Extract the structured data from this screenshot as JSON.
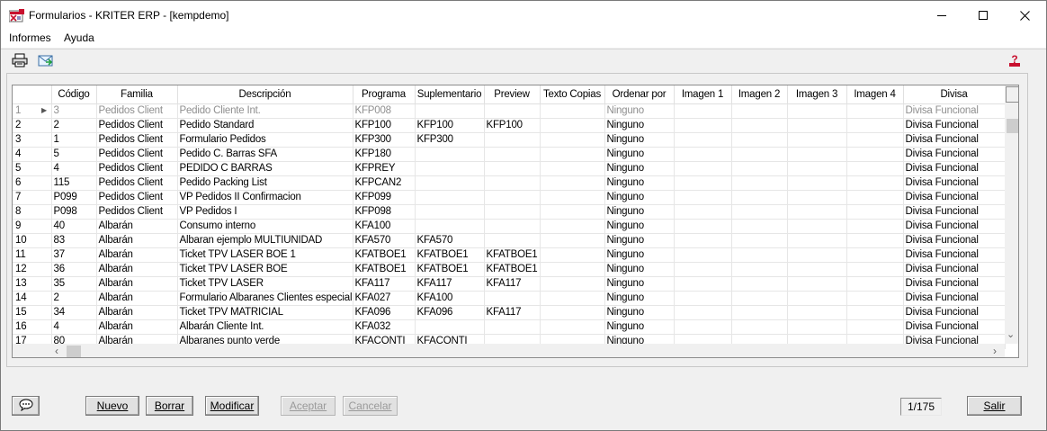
{
  "window": {
    "title": "Formularios - KRITER ERP - [kempdemo]",
    "controls": {
      "minimize": "—",
      "maximize": "☐",
      "close": "✕"
    }
  },
  "menu": {
    "informes": "Informes",
    "ayuda": "Ayuda"
  },
  "toolbar": {
    "icons": [
      "printer-icon",
      "email-export-icon",
      "help-icon"
    ]
  },
  "grid": {
    "columns": [
      "",
      "Código",
      "Familia",
      "Descripción",
      "Programa",
      "Suplementario",
      "Preview",
      "Texto Copias",
      "Ordenar por",
      "Imagen 1",
      "Imagen 2",
      "Imagen 3",
      "Imagen 4",
      "Divisa"
    ],
    "rows": [
      [
        "1",
        "3",
        "Pedidos Client",
        "Pedido Cliente Int.",
        "KFP008",
        "",
        "",
        "",
        "Ninguno",
        "",
        "",
        "",
        "",
        "Divisa Funcional"
      ],
      [
        "2",
        "2",
        "Pedidos Client",
        "Pedido Standard",
        "KFP100",
        "KFP100",
        "KFP100",
        "",
        "Ninguno",
        "",
        "",
        "",
        "",
        "Divisa Funcional"
      ],
      [
        "3",
        "1",
        "Pedidos Client",
        "Formulario Pedidos",
        "KFP300",
        "KFP300",
        "",
        "",
        "Ninguno",
        "",
        "",
        "",
        "",
        "Divisa Funcional"
      ],
      [
        "4",
        "5",
        "Pedidos Client",
        "Pedido C. Barras SFA",
        "KFP180",
        "",
        "",
        "",
        "Ninguno",
        "",
        "",
        "",
        "",
        "Divisa Funcional"
      ],
      [
        "5",
        "4",
        "Pedidos Client",
        "PEDIDO C BARRAS",
        "KFPREY",
        "",
        "",
        "",
        "Ninguno",
        "",
        "",
        "",
        "",
        "Divisa Funcional"
      ],
      [
        "6",
        "115",
        "Pedidos Client",
        "Pedido Packing List",
        "KFPCAN2",
        "",
        "",
        "",
        "Ninguno",
        "",
        "",
        "",
        "",
        "Divisa Funcional"
      ],
      [
        "7",
        "P099",
        "Pedidos Client",
        "VP Pedidos II Confirmacion",
        "KFP099",
        "",
        "",
        "",
        "Ninguno",
        "",
        "",
        "",
        "",
        "Divisa Funcional"
      ],
      [
        "8",
        "P098",
        "Pedidos Client",
        "VP Pedidos I",
        "KFP098",
        "",
        "",
        "",
        "Ninguno",
        "",
        "",
        "",
        "",
        "Divisa Funcional"
      ],
      [
        "9",
        "40",
        "Albarán",
        "Consumo interno",
        "KFA100",
        "",
        "",
        "",
        "Ninguno",
        "",
        "",
        "",
        "",
        "Divisa Funcional"
      ],
      [
        "10",
        "83",
        "Albarán",
        "Albaran ejemplo MULTIUNIDAD",
        "KFA570",
        "KFA570",
        "",
        "",
        "Ninguno",
        "",
        "",
        "",
        "",
        "Divisa Funcional"
      ],
      [
        "11",
        "37",
        "Albarán",
        "Ticket TPV LASER BOE 1",
        "KFATBOE1",
        "KFATBOE1",
        "KFATBOE1",
        "",
        "Ninguno",
        "",
        "",
        "",
        "",
        "Divisa Funcional"
      ],
      [
        "12",
        "36",
        "Albarán",
        "Ticket TPV LASER BOE",
        "KFATBOE1",
        "KFATBOE1",
        "KFATBOE1",
        "",
        "Ninguno",
        "",
        "",
        "",
        "",
        "Divisa Funcional"
      ],
      [
        "13",
        "35",
        "Albarán",
        "Ticket TPV LASER",
        "KFA117",
        "KFA117",
        "KFA117",
        "",
        "Ninguno",
        "",
        "",
        "",
        "",
        "Divisa Funcional"
      ],
      [
        "14",
        "2",
        "Albarán",
        "Formulario Albaranes Clientes especial",
        "KFA027",
        "KFA100",
        "",
        "",
        "Ninguno",
        "",
        "",
        "",
        "",
        "Divisa Funcional"
      ],
      [
        "15",
        "34",
        "Albarán",
        "Ticket TPV MATRICIAL",
        "KFA096",
        "KFA096",
        "KFA117",
        "",
        "Ninguno",
        "",
        "",
        "",
        "",
        "Divisa Funcional"
      ],
      [
        "16",
        "4",
        "Albarán",
        "Albarán Cliente Int.",
        "KFA032",
        "",
        "",
        "",
        "Ninguno",
        "",
        "",
        "",
        "",
        "Divisa Funcional"
      ],
      [
        "17",
        "80",
        "Albarán",
        "Albaranes punto verde",
        "KFACONTI",
        "KFACONTI",
        "",
        "",
        "Ninguno",
        "",
        "",
        "",
        "",
        "Divisa Funcional"
      ]
    ]
  },
  "footer": {
    "nuevo": "Nuevo",
    "borrar": "Borrar",
    "modificar": "Modificar",
    "aceptar": "Aceptar",
    "cancelar": "Cancelar",
    "counter": "1/175",
    "salir": "Salir"
  }
}
